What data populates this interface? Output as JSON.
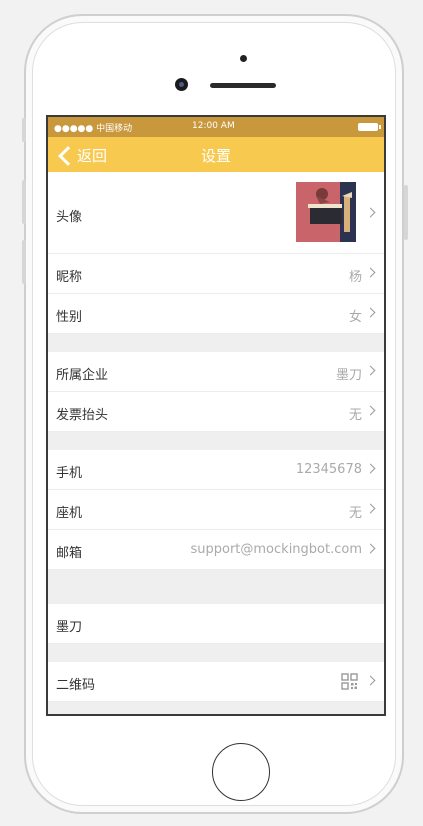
{
  "status_bar": {
    "carrier": "●●●●● 中国移动",
    "time": "12:00 AM"
  },
  "nav": {
    "back_label": "返回",
    "title": "设置"
  },
  "profile": [
    {
      "label": "头像"
    },
    {
      "label": "昵称",
      "value": "杨"
    },
    {
      "label": "性别",
      "value": "女"
    }
  ],
  "company": [
    {
      "label": "所属企业",
      "value": "墨刀"
    },
    {
      "label": "发票抬头",
      "value": "无"
    }
  ],
  "contact": [
    {
      "label": "手机",
      "value": "12345678"
    },
    {
      "label": "座机",
      "value": "无"
    },
    {
      "label": "邮箱",
      "value": "support@mockingbot.com"
    }
  ],
  "misc": {
    "brand": "墨刀",
    "qrcode_label": "二维码"
  },
  "colors": {
    "status_bar": "#c9973c",
    "nav_bar": "#f7c94f",
    "avatar_bg": "#c9646a"
  }
}
